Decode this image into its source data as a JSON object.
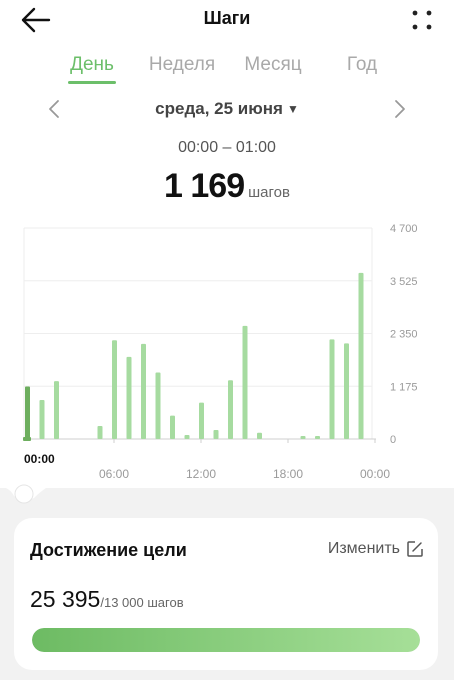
{
  "header": {
    "title": "Шаги"
  },
  "tabs": [
    {
      "label": "День",
      "active": true
    },
    {
      "label": "Неделя",
      "active": false
    },
    {
      "label": "Месяц",
      "active": false
    },
    {
      "label": "Год",
      "active": false
    }
  ],
  "date": {
    "label": "среда, 25 июня"
  },
  "selection": {
    "time_range": "00:00 – 01:00",
    "steps": "1 169",
    "unit": "шагов",
    "bar_label": "00:00"
  },
  "chart_data": {
    "type": "bar",
    "categories": [
      "00:00",
      "01:00",
      "02:00",
      "03:00",
      "04:00",
      "05:00",
      "06:00",
      "07:00",
      "08:00",
      "09:00",
      "10:00",
      "11:00",
      "12:00",
      "13:00",
      "14:00",
      "15:00",
      "16:00",
      "17:00",
      "18:00",
      "19:00",
      "20:00",
      "21:00",
      "22:00",
      "23:00"
    ],
    "values": [
      1169,
      870,
      1290,
      0,
      0,
      290,
      2200,
      1830,
      2120,
      1480,
      520,
      90,
      810,
      200,
      1310,
      2520,
      140,
      0,
      0,
      30,
      30,
      2220,
      2130,
      3700
    ],
    "selected_index": 0,
    "x_tick_labels": [
      "06:00",
      "12:00",
      "18:00",
      "00:00"
    ],
    "y_tick_labels": [
      "4 700",
      "3 525",
      "2 350",
      "1 175",
      "0"
    ],
    "ylim": [
      0,
      4700
    ],
    "grid": true,
    "colors": {
      "bar": "#a6dba0",
      "selected": "#6dae5e"
    }
  },
  "goal": {
    "title": "Достижение цели",
    "edit_label": "Изменить",
    "current": "25 395",
    "target": "/13 000 шагов",
    "progress_fraction": 1.0
  },
  "colors": {
    "accent": "#6cbf6a"
  }
}
